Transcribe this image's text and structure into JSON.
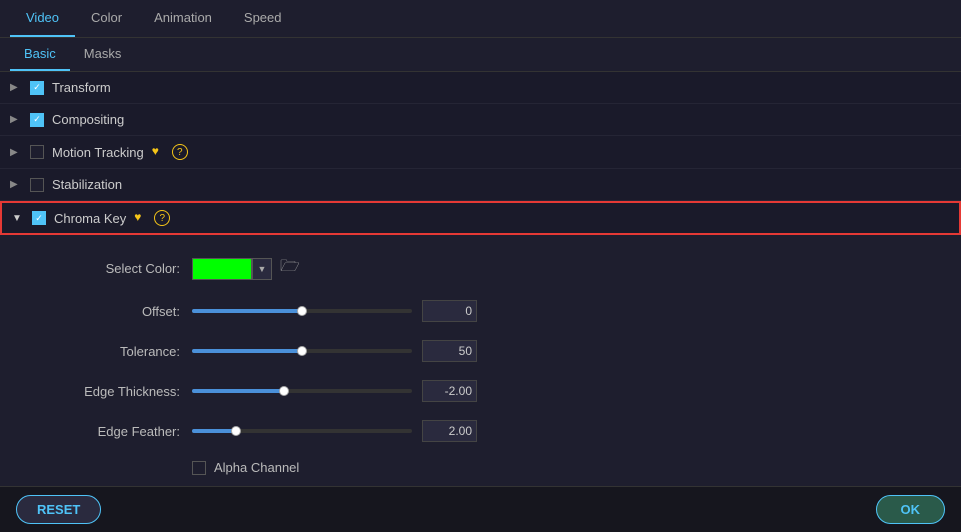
{
  "tabs": {
    "top": [
      {
        "label": "Video",
        "active": true
      },
      {
        "label": "Color",
        "active": false
      },
      {
        "label": "Animation",
        "active": false
      },
      {
        "label": "Speed",
        "active": false
      }
    ],
    "sub": [
      {
        "label": "Basic",
        "active": true
      },
      {
        "label": "Masks",
        "active": false
      }
    ]
  },
  "sections": [
    {
      "label": "Transform",
      "checked": true,
      "expanded": false,
      "highlighted": false
    },
    {
      "label": "Compositing",
      "checked": true,
      "expanded": false,
      "highlighted": false
    },
    {
      "label": "Motion Tracking",
      "checked": false,
      "expanded": false,
      "highlighted": false,
      "hasHeart": true,
      "hasQuestion": true
    },
    {
      "label": "Stabilization",
      "checked": false,
      "expanded": false,
      "highlighted": false
    },
    {
      "label": "Chroma Key",
      "checked": true,
      "expanded": true,
      "highlighted": true,
      "hasHeart": true,
      "hasQuestion": true
    }
  ],
  "chromaKey": {
    "selectColorLabel": "Select Color:",
    "offsetLabel": "Offset:",
    "toleranceLabel": "Tolerance:",
    "edgeThicknessLabel": "Edge Thickness:",
    "edgeFeatherLabel": "Edge Feather:",
    "alphaChannelLabel": "Alpha Channel",
    "offsetValue": "0",
    "toleranceValue": "50",
    "edgeThicknessValue": "-2.00",
    "edgeFeatherValue": "2.00",
    "offsetPercent": 50,
    "tolerancePercent": 50,
    "edgeThicknessPercent": 42,
    "edgeFeatherPercent": 20
  },
  "bottomBar": {
    "resetLabel": "RESET",
    "okLabel": "OK"
  }
}
